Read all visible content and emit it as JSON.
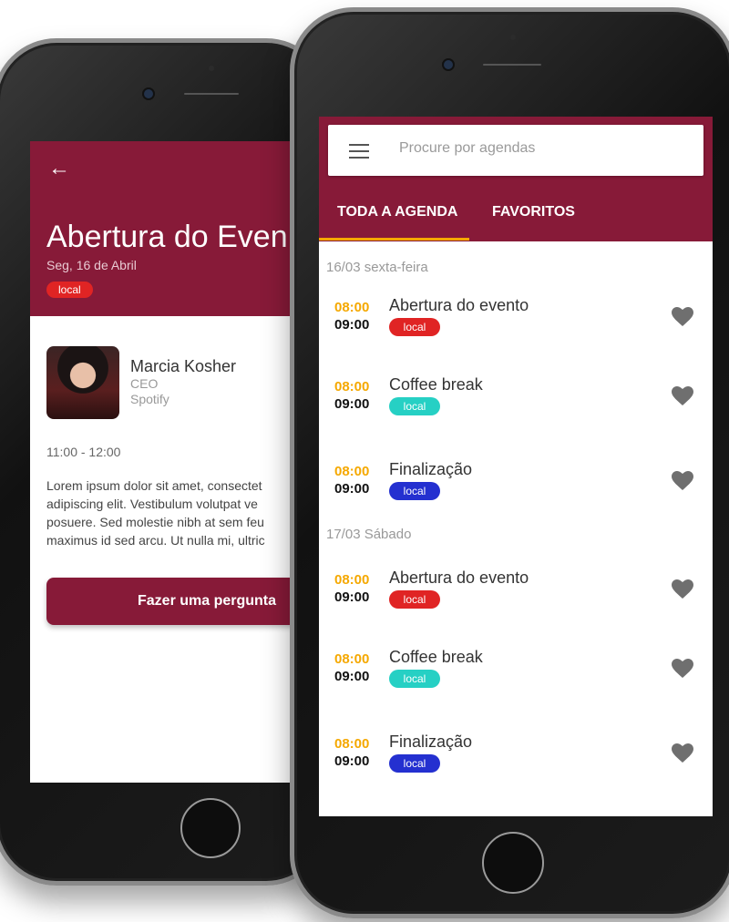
{
  "detail": {
    "back_icon": "arrow-left-icon",
    "title": "Abertura do Even",
    "date": "Seg, 16 de Abril",
    "chip": {
      "label": "local",
      "color": "#e02424"
    },
    "speaker": {
      "name": "Marcia Kosher",
      "role": "CEO",
      "company": "Spotify"
    },
    "time_range": "11:00 - 12:00",
    "description_lines": [
      "Lorem ipsum dolor sit amet, consectet",
      "adipiscing elit. Vestibulum volutpat ve",
      "posuere. Sed molestie nibh at sem feu",
      "maximus id sed arcu. Ut nulla mi, ultric"
    ],
    "ask_button": "Fazer uma pergunta"
  },
  "agenda": {
    "search": {
      "placeholder": "Procure por agendas",
      "value": ""
    },
    "menu_icon": "hamburger-menu-icon",
    "tabs": [
      {
        "label": "TODA A AGENDA",
        "active": true
      },
      {
        "label": "FAVORITOS",
        "active": false
      }
    ],
    "days": [
      {
        "label": "16/03 sexta-feira",
        "events": [
          {
            "start": "08:00",
            "end": "09:00",
            "title": "Abertura do evento",
            "chip": "local",
            "chip_color": "#e02424"
          },
          {
            "start": "08:00",
            "end": "09:00",
            "title": "Coffee break",
            "chip": "local",
            "chip_color": "#26d0c4"
          },
          {
            "start": "08:00",
            "end": "09:00",
            "title": "Finalização",
            "chip": "local",
            "chip_color": "#2430d0"
          }
        ]
      },
      {
        "label": "17/03 Sábado",
        "events": [
          {
            "start": "08:00",
            "end": "09:00",
            "title": "Abertura do evento",
            "chip": "local",
            "chip_color": "#e02424"
          },
          {
            "start": "08:00",
            "end": "09:00",
            "title": "Coffee break",
            "chip": "local",
            "chip_color": "#26d0c4"
          },
          {
            "start": "08:00",
            "end": "09:00",
            "title": "Finalização",
            "chip": "local",
            "chip_color": "#2430d0"
          }
        ]
      }
    ],
    "favorite_icon": "heart-icon"
  },
  "colors": {
    "primary": "#871a38",
    "accent": "#f5a800"
  }
}
